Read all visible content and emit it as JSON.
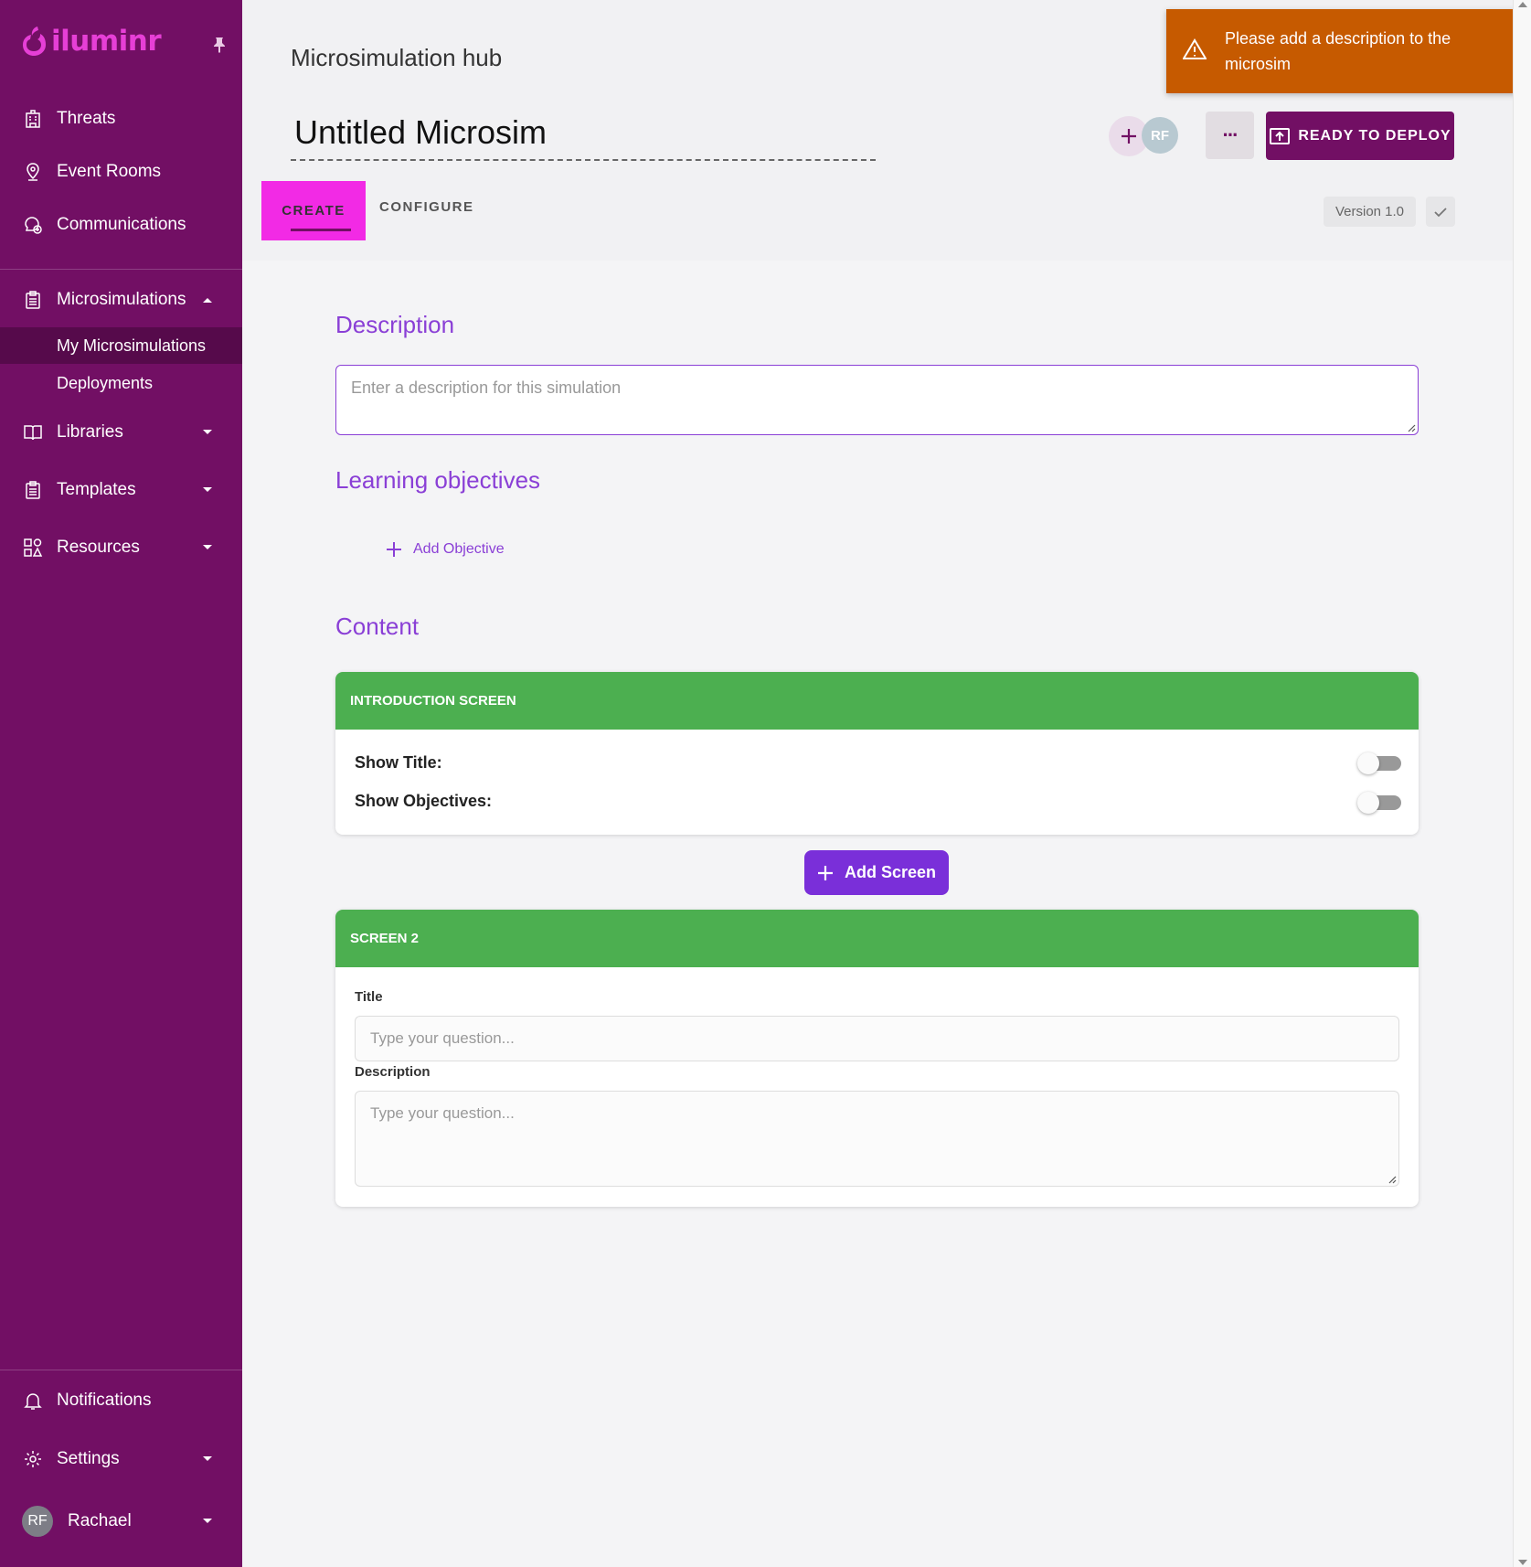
{
  "brand": {
    "name": "iluminr",
    "color": "#720f64",
    "accent": "#e63fd6"
  },
  "sidebar": {
    "items": [
      {
        "label": "Threats",
        "icon": "building-icon"
      },
      {
        "label": "Event Rooms",
        "icon": "location-pin-icon"
      },
      {
        "label": "Communications",
        "icon": "chat-icon"
      },
      {
        "label": "Microsimulations",
        "icon": "clipboard-icon"
      },
      {
        "label": "Libraries",
        "icon": "book-icon"
      },
      {
        "label": "Templates",
        "icon": "clipboard-icon"
      },
      {
        "label": "Resources",
        "icon": "shapes-icon"
      }
    ],
    "sub_items": [
      {
        "label": "My Microsimulations"
      },
      {
        "label": "Deployments"
      }
    ],
    "bottom": [
      {
        "label": "Notifications",
        "icon": "bell-icon"
      },
      {
        "label": "Settings",
        "icon": "gear-icon"
      }
    ],
    "user": {
      "initials": "RF",
      "name": "Rachael"
    }
  },
  "header": {
    "hub_title": "Microsimulation hub",
    "sim_title": "Untitled Microsim",
    "collaborator_initials": "RF",
    "more_label": "···",
    "deploy_label": "READY TO DEPLOY",
    "version": "Version 1.0"
  },
  "tabs": [
    {
      "label": "CREATE"
    },
    {
      "label": "CONFIGURE"
    }
  ],
  "toast": {
    "message": "Please add a description to the microsim",
    "color": "#c65a00"
  },
  "description": {
    "title": "Description",
    "placeholder": "Enter a description for this simulation"
  },
  "objectives": {
    "title": "Learning objectives",
    "add_label": "Add Objective"
  },
  "content": {
    "title": "Content",
    "intro_card": {
      "header": "INTRODUCTION SCREEN",
      "rows": [
        {
          "label": "Show Title:"
        },
        {
          "label": "Show Objectives:"
        }
      ]
    },
    "add_screen_label": "Add Screen",
    "screen2": {
      "header": "SCREEN 2",
      "title_label": "Title",
      "title_placeholder": "Type your question...",
      "desc_label": "Description",
      "desc_placeholder": "Type your question..."
    },
    "card_header_color": "#4caf50"
  }
}
